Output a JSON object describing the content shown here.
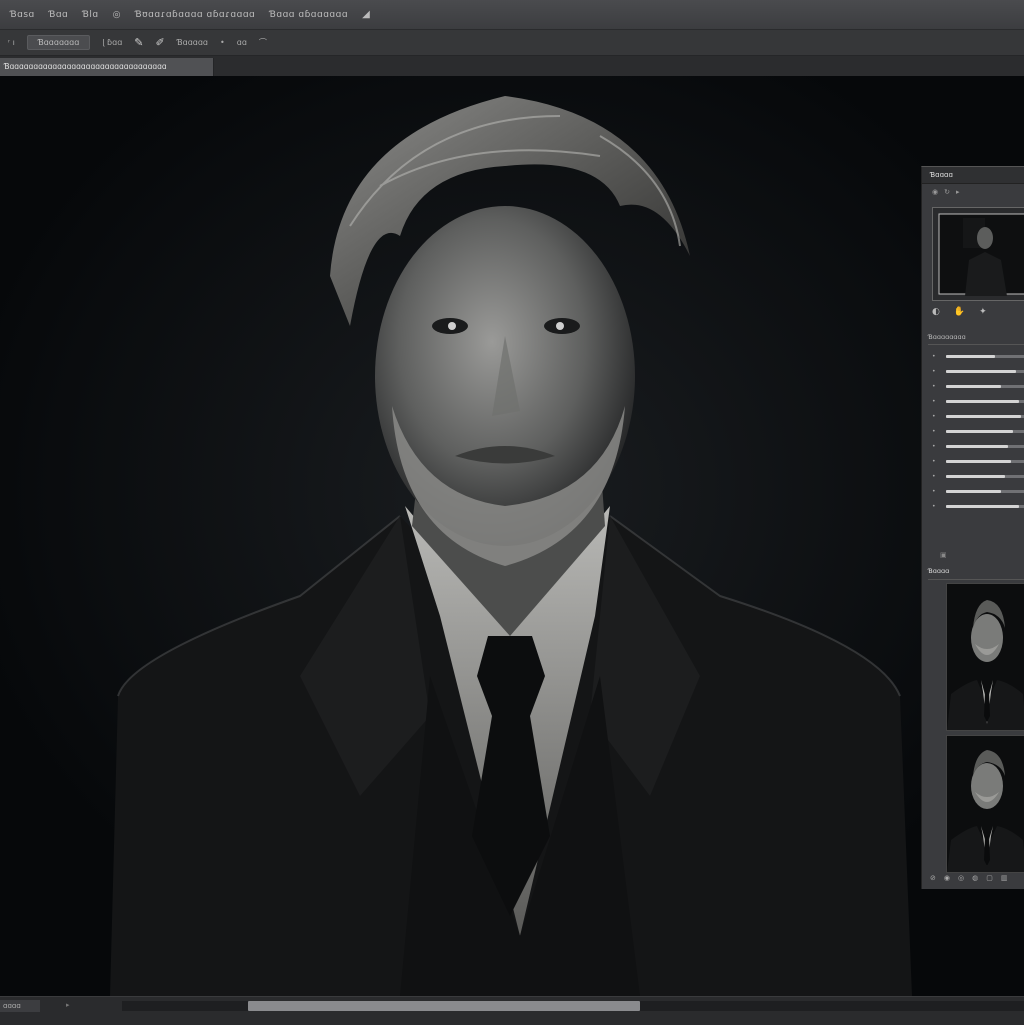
{
  "app": {
    "menu": [
      "Ɓɑsɑ",
      "Ɓɑɑ",
      "Ɓlɑ",
      "◎",
      "Ɓʊɑɑɾɑɓɑɑɑɑ ɑɓɑɾɑɑɑɑ",
      "Ɓɑɑɑ ɑɓɑɑɑɑɑɑ"
    ],
    "menu_icon": "brush-triangle-icon"
  },
  "options_bar": {
    "items": [
      "ʳ ı",
      "Ɓɑɑɑɑɑɑɑ",
      "ɭ ɓɑɑ",
      "Ɓɑɑɑɑɑ",
      "•",
      "ɑɑ",
      "⌒"
    ],
    "tool_icons": [
      "pencil-icon",
      "brush-icon"
    ]
  },
  "document": {
    "tab_title": "Ɓɑɑɑɑɑɑɑɑɑɑɑɑɑɑɑɑɑɑɑɑɑɑɑɑɑɑɑɑɑɑɑɑɑ"
  },
  "canvas": {
    "subject": "monochrome-portrait-man-in-suit"
  },
  "panels": {
    "navigator": {
      "title": "Ɓɑɑɑɑ"
    },
    "properties": {
      "title": "Ɓɑɑɑɑɑɑɑɑ",
      "sliders": [
        0.62,
        0.88,
        0.7,
        0.93,
        0.95,
        0.85,
        0.78,
        0.82,
        0.75,
        0.7,
        0.93
      ]
    },
    "layers": {
      "title": "Ɓɑɑɑɑ"
    }
  },
  "status": {
    "zoom": "ɑɑɑɑ",
    "scroll_position": 0.14
  },
  "colors": {
    "chrome_dark": "#2b2c2e",
    "chrome_mid": "#3a3b3e",
    "canvas_bg": "#07090b"
  }
}
